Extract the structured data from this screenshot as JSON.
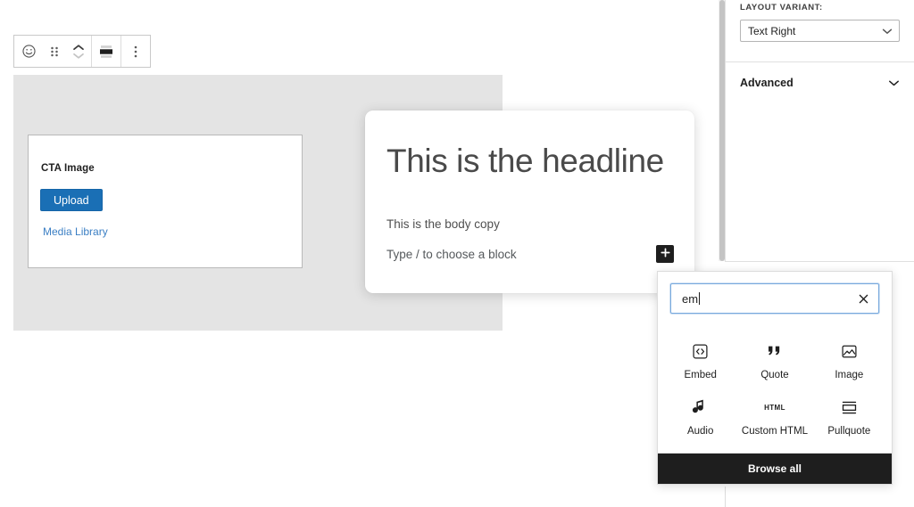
{
  "toolbar": {
    "buttons": [
      {
        "name": "block-type-icon",
        "label": "Change block type"
      },
      {
        "name": "drag-handle-icon",
        "label": "Drag"
      },
      {
        "name": "move-updown-icon",
        "label": "Move up or down"
      },
      {
        "name": "vertical-align-icon",
        "label": "Change vertical alignment"
      },
      {
        "name": "more-options-icon",
        "label": "Options"
      }
    ]
  },
  "canvas": {
    "cta": {
      "field_label": "CTA Image",
      "upload_button": "Upload",
      "media_library_link": "Media Library"
    },
    "content": {
      "headline": "This is the headline",
      "body_copy": "This is the body copy",
      "placeholder": "Type / to choose a block",
      "add_block_button": "+"
    }
  },
  "sidebar": {
    "layout_variant_label": "LAYOUT VARIANT:",
    "layout_variant_value": "Text Right",
    "advanced_panel_title": "Advanced"
  },
  "inserter": {
    "search_value": "em",
    "clear_label": "×",
    "blocks": [
      {
        "label": "Embed",
        "icon": "embed-icon"
      },
      {
        "label": "Quote",
        "icon": "quote-icon"
      },
      {
        "label": "Image",
        "icon": "image-icon"
      },
      {
        "label": "Audio",
        "icon": "audio-icon"
      },
      {
        "label": "Custom HTML",
        "icon": "custom-html-icon"
      },
      {
        "label": "Pullquote",
        "icon": "pullquote-icon"
      }
    ],
    "browse_all_label": "Browse all"
  },
  "colors": {
    "accent_blue": "#1a6fb5",
    "link_blue": "#3b7fc4",
    "canvas_grey": "#e4e4e4",
    "dark": "#1e1e1e",
    "focus_blue": "#78a9dd"
  }
}
